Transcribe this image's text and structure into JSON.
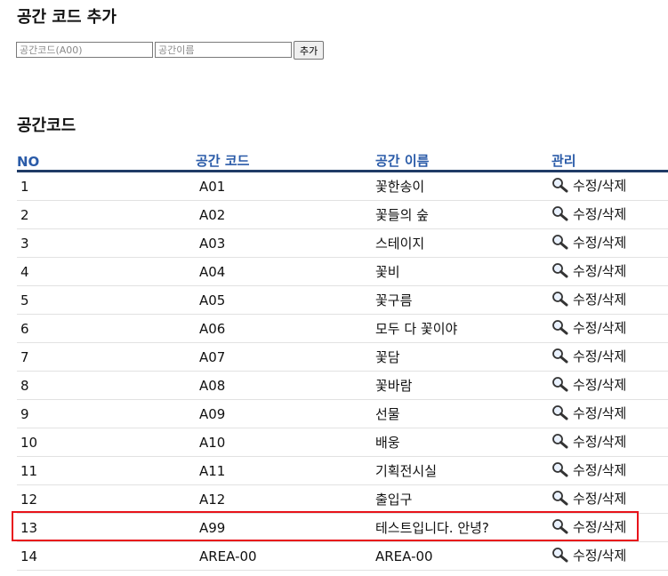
{
  "add_section": {
    "title": "공간 코드 추가",
    "code_placeholder": "공간코드(A00)",
    "name_placeholder": "공간이름",
    "code_value": "",
    "name_value": "",
    "add_label": "추가"
  },
  "list_section": {
    "title": "공간코드",
    "columns": [
      "NO",
      "공간 코드",
      "공간 이름",
      "관리"
    ],
    "manage_label": "수정/삭제",
    "rows": [
      {
        "no": "1",
        "code": "A01",
        "name": "꽃한송이"
      },
      {
        "no": "2",
        "code": "A02",
        "name": "꽃들의 숲"
      },
      {
        "no": "3",
        "code": "A03",
        "name": "스테이지"
      },
      {
        "no": "4",
        "code": "A04",
        "name": "꽃비"
      },
      {
        "no": "5",
        "code": "A05",
        "name": "꽃구름"
      },
      {
        "no": "6",
        "code": "A06",
        "name": "모두 다 꽃이야"
      },
      {
        "no": "7",
        "code": "A07",
        "name": "꽃담"
      },
      {
        "no": "8",
        "code": "A08",
        "name": "꽃바람"
      },
      {
        "no": "9",
        "code": "A09",
        "name": "선물"
      },
      {
        "no": "10",
        "code": "A10",
        "name": "배웅"
      },
      {
        "no": "11",
        "code": "A11",
        "name": "기획전시실"
      },
      {
        "no": "12",
        "code": "A12",
        "name": "출입구"
      },
      {
        "no": "13",
        "code": "A99",
        "name": "테스트입니다. 안녕?",
        "highlighted": true
      },
      {
        "no": "14",
        "code": "AREA-00",
        "name": "AREA-00"
      }
    ]
  },
  "colors": {
    "header_text": "#2a5ba8",
    "header_rule": "#1f3b66",
    "highlight_border": "#e8131b",
    "row_divider": "#e2e2e2"
  },
  "icons": {
    "manage": "search-icon"
  }
}
